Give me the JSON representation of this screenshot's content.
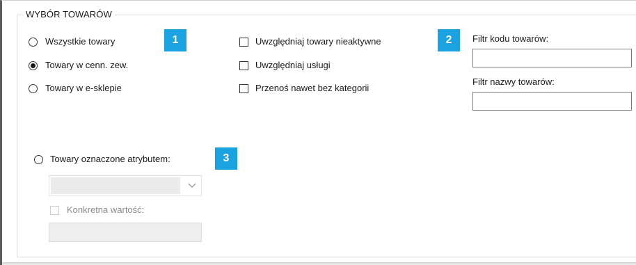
{
  "group": {
    "title": "WYBÓR TOWARÓW"
  },
  "scope_options": [
    {
      "label": "Wszystkie towary",
      "checked": false
    },
    {
      "label": "Towary w cenn. zew.",
      "checked": true
    },
    {
      "label": "Towary w e-sklepie",
      "checked": false
    }
  ],
  "include_options": [
    {
      "label": "Uwzględniaj towary nieaktywne",
      "checked": false
    },
    {
      "label": "Uwzględniaj usługi",
      "checked": false
    },
    {
      "label": "Przenoś nawet bez kategorii",
      "checked": false
    }
  ],
  "filters": {
    "code_label": "Filtr kodu towarów:",
    "code_value": "",
    "name_label": "Filtr nazwy towarów:",
    "name_value": ""
  },
  "attribute": {
    "radio_label": "Towary oznaczone atrybutem:",
    "checked": false,
    "select_value": "",
    "specific_value_label": "Konkretna wartość:",
    "specific_value_checked": false,
    "specific_value": ""
  },
  "badges": [
    "1",
    "2",
    "3"
  ],
  "colors": {
    "badge": "#1aa3e0"
  }
}
